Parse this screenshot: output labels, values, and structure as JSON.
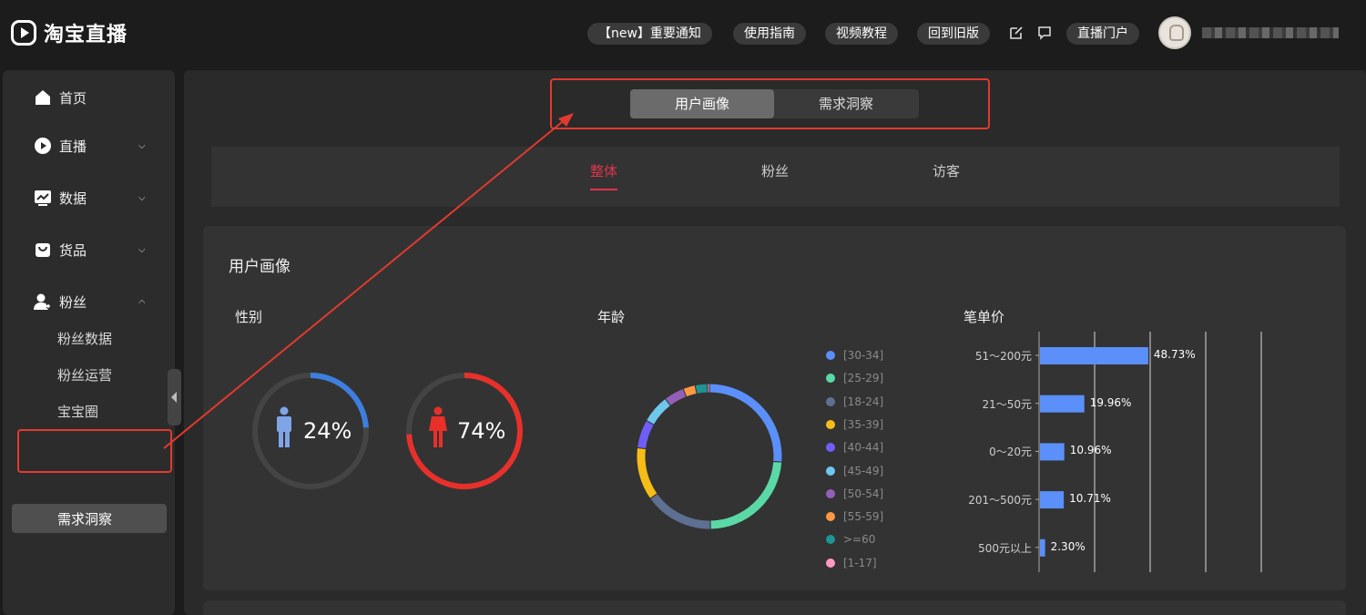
{
  "header": {
    "logo_text": "淘宝直播",
    "buttons": [
      "【new】重要通知",
      "使用指南",
      "视频教程",
      "回到旧版",
      "直播门户"
    ],
    "icons": [
      "edit-icon",
      "message-icon"
    ]
  },
  "sidebar": {
    "items": [
      {
        "label": "首页",
        "icon": "home-icon"
      },
      {
        "label": "直播",
        "icon": "play-icon"
      },
      {
        "label": "数据",
        "icon": "chart-icon"
      },
      {
        "label": "货品",
        "icon": "bag-icon"
      },
      {
        "label": "粉丝",
        "icon": "fans-icon"
      }
    ],
    "sub_items": [
      "粉丝数据",
      "粉丝运营",
      "宝宝圈",
      "需求洞察"
    ],
    "active_sub": "需求洞察"
  },
  "main": {
    "segments": [
      "用户画像",
      "需求洞察"
    ],
    "active_segment": "用户画像",
    "subtabs": [
      "整体",
      "粉丝",
      "访客"
    ],
    "active_subtab": "整体",
    "card_title": "用户画像",
    "gender": {
      "title": "性别",
      "male_pct": "24%",
      "female_pct": "74%",
      "male_value": 0.24,
      "female_value": 0.74,
      "male_color": "#3c7fe0",
      "female_color": "#e8302a"
    },
    "age": {
      "title": "年龄",
      "legend": [
        "[30-34]",
        "[25-29]",
        "[18-24]",
        "[35-39]",
        "[40-44]",
        "[45-49]",
        "[50-54]",
        "[55-59]",
        ">=60",
        "[1-17]"
      ],
      "colors": [
        "#5b8ff9",
        "#5ad8a6",
        "#5d7092",
        "#f6bd16",
        "#6f5ef9",
        "#6dc8ec",
        "#945fb9",
        "#ff9845",
        "#1e9493",
        "#ff99c3"
      ],
      "values": [
        29,
        26,
        17,
        13,
        7,
        7,
        5,
        3,
        3,
        0.5
      ]
    },
    "price": {
      "title": "笔单价",
      "categories": [
        "51～200元",
        "21～50元",
        "0～20元",
        "201～500元",
        "500元以上"
      ],
      "labels": [
        "48.73%",
        "19.96%",
        "10.96%",
        "10.71%",
        "2.30%"
      ],
      "values": [
        48.73,
        19.96,
        10.96,
        10.71,
        2.3
      ]
    }
  },
  "chart_data": [
    {
      "type": "pie",
      "title": "年龄",
      "categories": [
        "[30-34]",
        "[25-29]",
        "[18-24]",
        "[35-39]",
        "[40-44]",
        "[45-49]",
        "[50-54]",
        "[55-59]",
        ">=60",
        "[1-17]"
      ],
      "values": [
        29,
        26,
        17,
        13,
        7,
        7,
        5,
        3,
        3,
        0.5
      ]
    },
    {
      "type": "bar",
      "title": "笔单价",
      "categories": [
        "51～200元",
        "21～50元",
        "0～20元",
        "201～500元",
        "500元以上"
      ],
      "values": [
        48.73,
        19.96,
        10.96,
        10.71,
        2.3
      ]
    }
  ]
}
